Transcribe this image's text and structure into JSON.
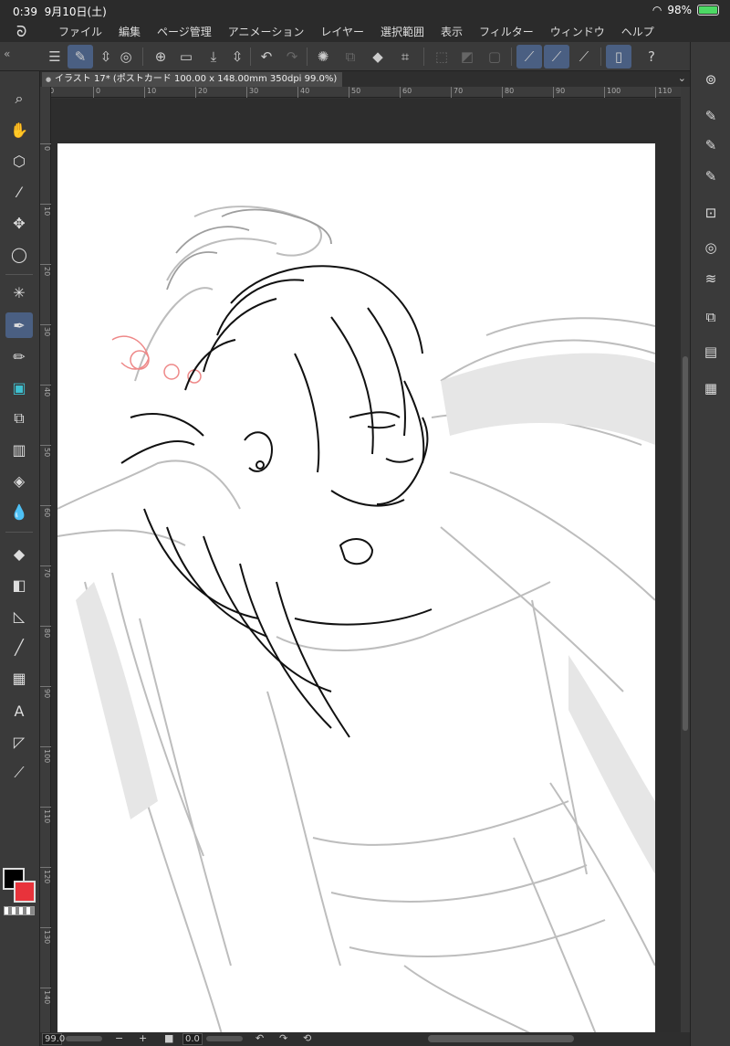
{
  "status": {
    "time": "0:39",
    "date": "9月10日(土)",
    "battery_percent_text": "98%",
    "battery_level": 0.98
  },
  "menu": {
    "items": [
      "ファイル",
      "編集",
      "ページ管理",
      "アニメーション",
      "レイヤー",
      "選択範囲",
      "表示",
      "フィルター",
      "ウィンドウ",
      "ヘルプ"
    ]
  },
  "document": {
    "tab_title": "イラスト 17* (ポストカード 100.00 x 148.00mm 350dpi 99.0%)"
  },
  "rulers": {
    "top_ticks": [
      "10",
      "0",
      "10",
      "20",
      "30",
      "40",
      "50",
      "60",
      "70",
      "80",
      "90",
      "100",
      "110"
    ],
    "left_ticks": [
      "0",
      "10",
      "20",
      "30",
      "40",
      "50",
      "60",
      "70",
      "80",
      "90",
      "100",
      "110",
      "120",
      "130",
      "140"
    ]
  },
  "bottom": {
    "zoom_value": "99.0",
    "rotation_value": "0.0",
    "minus_label": "−",
    "plus_label": "+"
  },
  "colors": {
    "main_color": "#000000",
    "sub_color": "#e8333b",
    "accent": "#4a5f82"
  }
}
